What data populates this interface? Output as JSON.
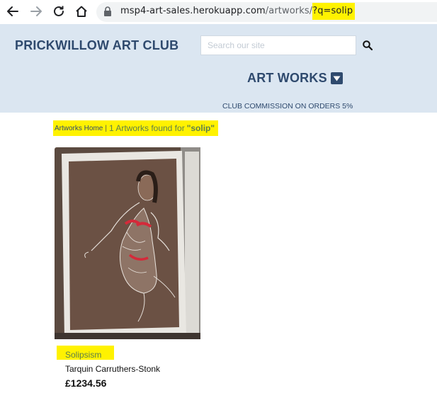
{
  "browser": {
    "url_host": "msp4-art-sales.herokuapp.com",
    "url_path": "/artworks/",
    "url_query": "?q=solip"
  },
  "header": {
    "brand": "PRICKWILLOW ART CLUB",
    "search_placeholder": "Search our site",
    "menu_title": "ART WORKS",
    "commission_note": "CLUB COMMISSION ON ORDERS 5%"
  },
  "results": {
    "home_link": "Artworks Home",
    "separator": "|",
    "found_text": "1 Artworks found for",
    "search_term": "\"solip\""
  },
  "artworks": [
    {
      "title": "Solipsism",
      "artist": "Tarquin Carruthers-Stonk",
      "price": "£1234.56"
    }
  ],
  "colors": {
    "header_bg": "#dbe6f1",
    "brand_text": "#2f4a6e",
    "highlight": "#fff200",
    "link_green": "#5e7f4c"
  },
  "icons": [
    "back-arrow-icon",
    "forward-arrow-icon",
    "reload-icon",
    "home-icon",
    "lock-icon",
    "search-icon",
    "caret-down-icon"
  ]
}
